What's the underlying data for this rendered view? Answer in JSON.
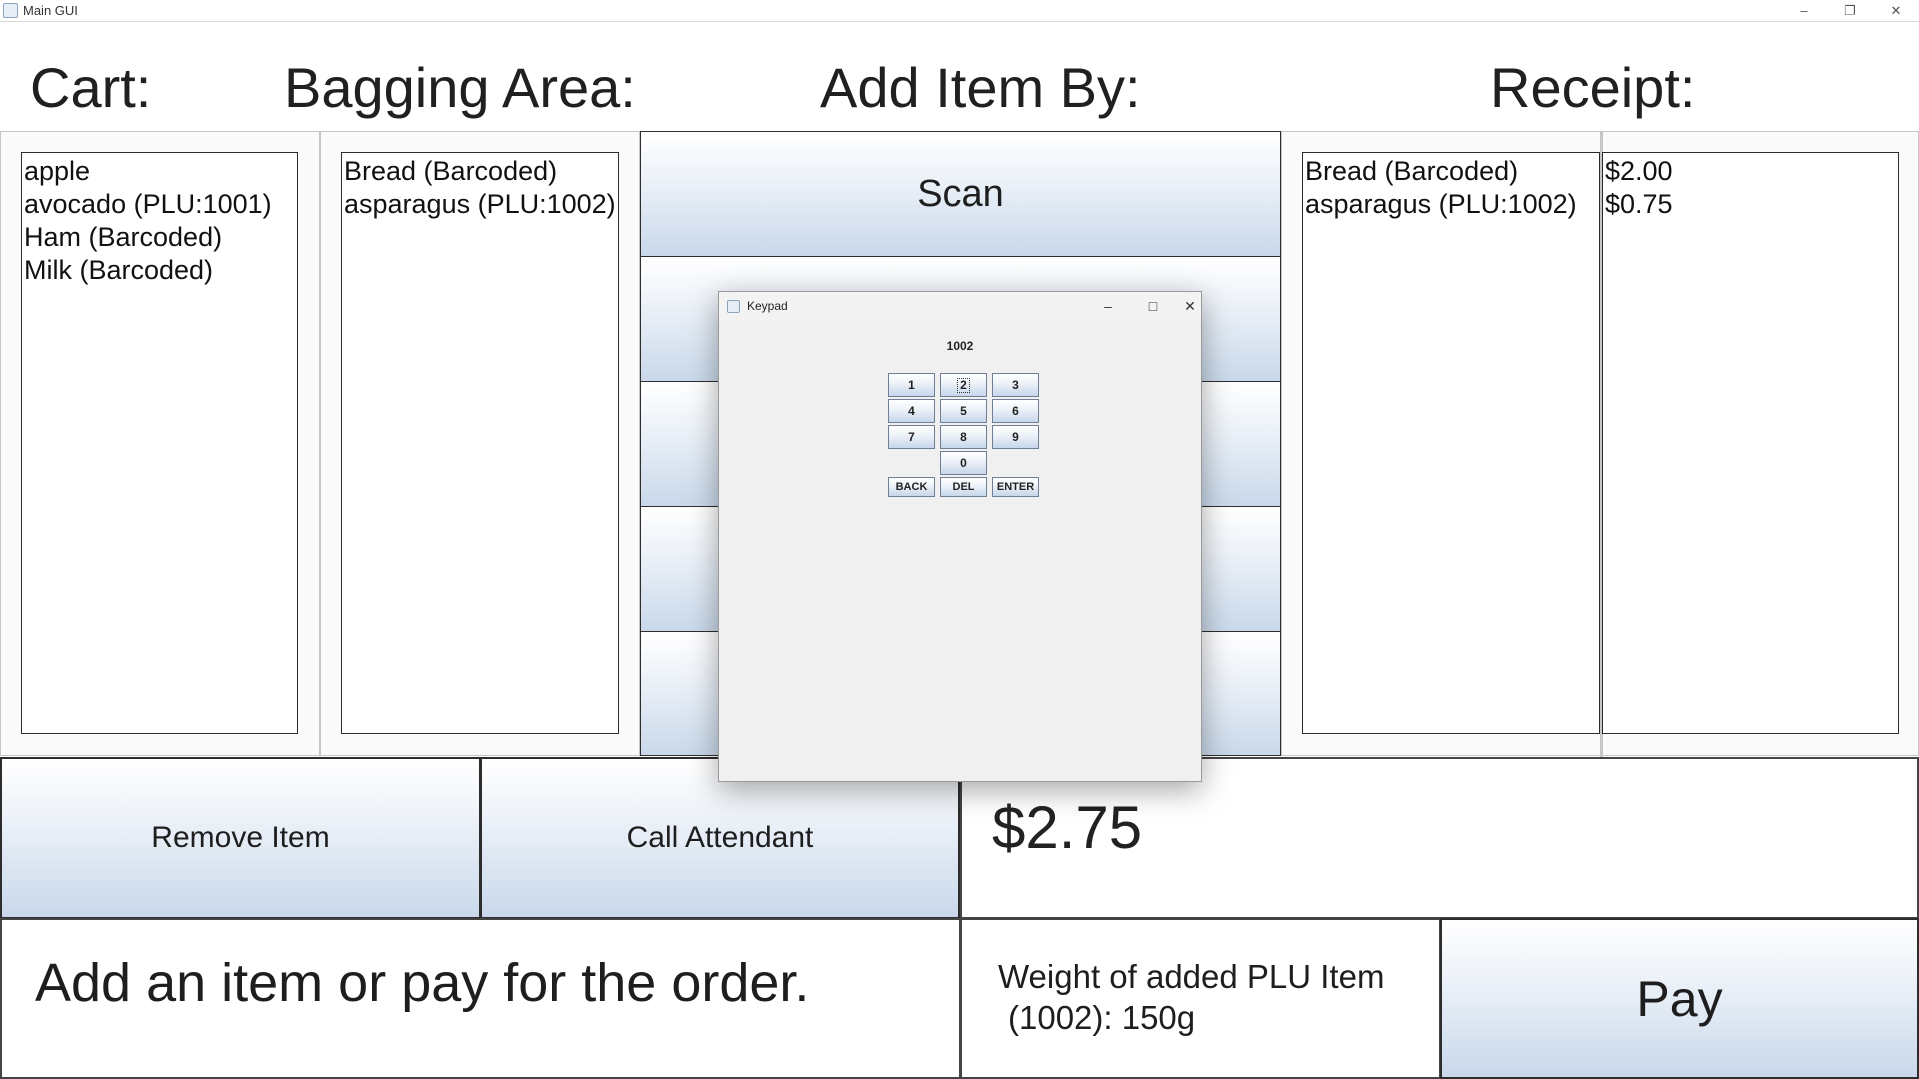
{
  "window": {
    "title": "Main GUI",
    "minimize": "–",
    "restore": "❐",
    "close": "✕"
  },
  "headers": {
    "cart": "Cart:",
    "bagging": "Bagging Area:",
    "add_item_by": "Add Item By:",
    "receipt": "Receipt:"
  },
  "cart": {
    "items": [
      "apple",
      "avocado (PLU:1001)",
      "Ham (Barcoded)",
      "Milk (Barcoded)"
    ]
  },
  "bagging": {
    "items": [
      "Bread (Barcoded)",
      "asparagus (PLU:1002)"
    ]
  },
  "add_item": {
    "scan_label": "Scan"
  },
  "receipt": {
    "items": [
      "Bread (Barcoded)",
      "asparagus (PLU:1002)"
    ],
    "prices": [
      "$2.00",
      "$0.75"
    ]
  },
  "actions": {
    "remove_item": "Remove Item",
    "call_attendant": "Call Attendant",
    "pay": "Pay"
  },
  "total": "$2.75",
  "message": "Add an item or pay for the order.",
  "weight_line1": "Weight of added PLU Item",
  "weight_line2": "(1002): 150g",
  "keypad": {
    "title": "Keypad",
    "display": "1002",
    "minimize": "–",
    "maximize": "□",
    "close": "✕",
    "keys": [
      "1",
      "2",
      "3",
      "4",
      "5",
      "6",
      "7",
      "8",
      "9",
      "0"
    ],
    "back": "BACK",
    "del": "DEL",
    "enter": "ENTER"
  },
  "colors": {
    "button_gradient_bottom": "#c9d8ea",
    "border": "#2d2d2d"
  }
}
